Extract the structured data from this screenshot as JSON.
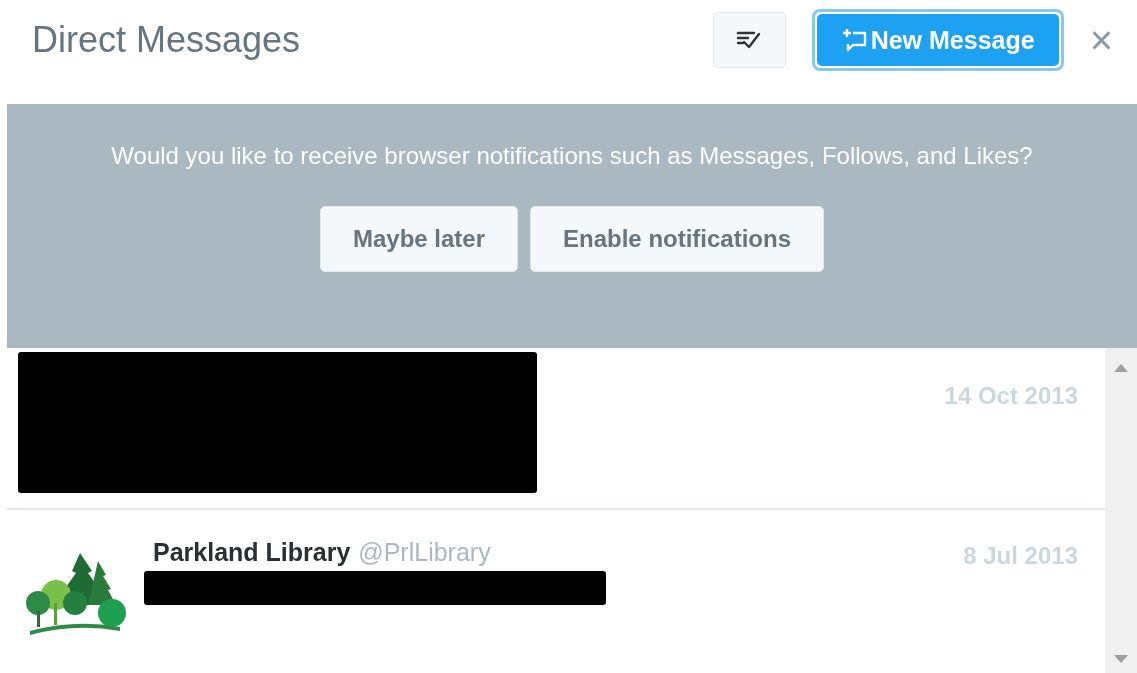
{
  "header": {
    "title": "Direct Messages",
    "new_message_button": "New Message",
    "close": "×"
  },
  "notification_banner": {
    "text": "Would you like to receive browser notifications such as Messages, Follows, and Likes?",
    "buttons": [
      "Maybe later",
      "Enable notifications"
    ]
  },
  "conversations": [
    {
      "kind": "redacted",
      "date": "14 Oct 2013"
    },
    {
      "kind": "conversation",
      "name": "Parkland Library",
      "handle": "@PrlLibrary",
      "date": "8 Jul 2013"
    }
  ]
}
